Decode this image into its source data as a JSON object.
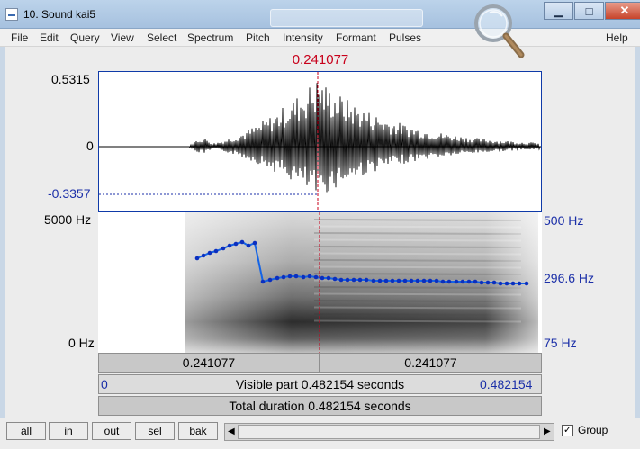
{
  "window": {
    "title": "10. Sound kai5",
    "minimize": "▁",
    "maximize": "□",
    "close": "✕"
  },
  "menu": [
    "File",
    "Edit",
    "Query",
    "View",
    "Select",
    "Spectrum",
    "Pitch",
    "Intensity",
    "Formant",
    "Pulses",
    "Help"
  ],
  "waveform": {
    "cursor_time": "0.241077",
    "y_max": "0.5315",
    "y_zero": "0",
    "y_min": "-0.3357"
  },
  "spectrogram": {
    "freq_max": "5000 Hz",
    "freq_min": "0 Hz",
    "pitch_max": "500 Hz",
    "pitch_current": "296.6 Hz",
    "pitch_min": "75 Hz"
  },
  "time_bars": {
    "left_segment": "0.241077",
    "right_segment": "0.241077",
    "visible_start": "0",
    "visible_label": "Visible part 0.482154 seconds",
    "visible_end": "0.482154",
    "total_label": "Total duration 0.482154 seconds"
  },
  "toolbar": {
    "buttons": [
      "all",
      "in",
      "out",
      "sel",
      "bak"
    ],
    "group_label": "Group",
    "group_checked": true,
    "scroll_left": "◀",
    "scroll_right": "▶"
  },
  "colors": {
    "cursor": "#c8001b",
    "axis_blue": "#1b2fa8",
    "pitch_line": "#1464e6"
  }
}
